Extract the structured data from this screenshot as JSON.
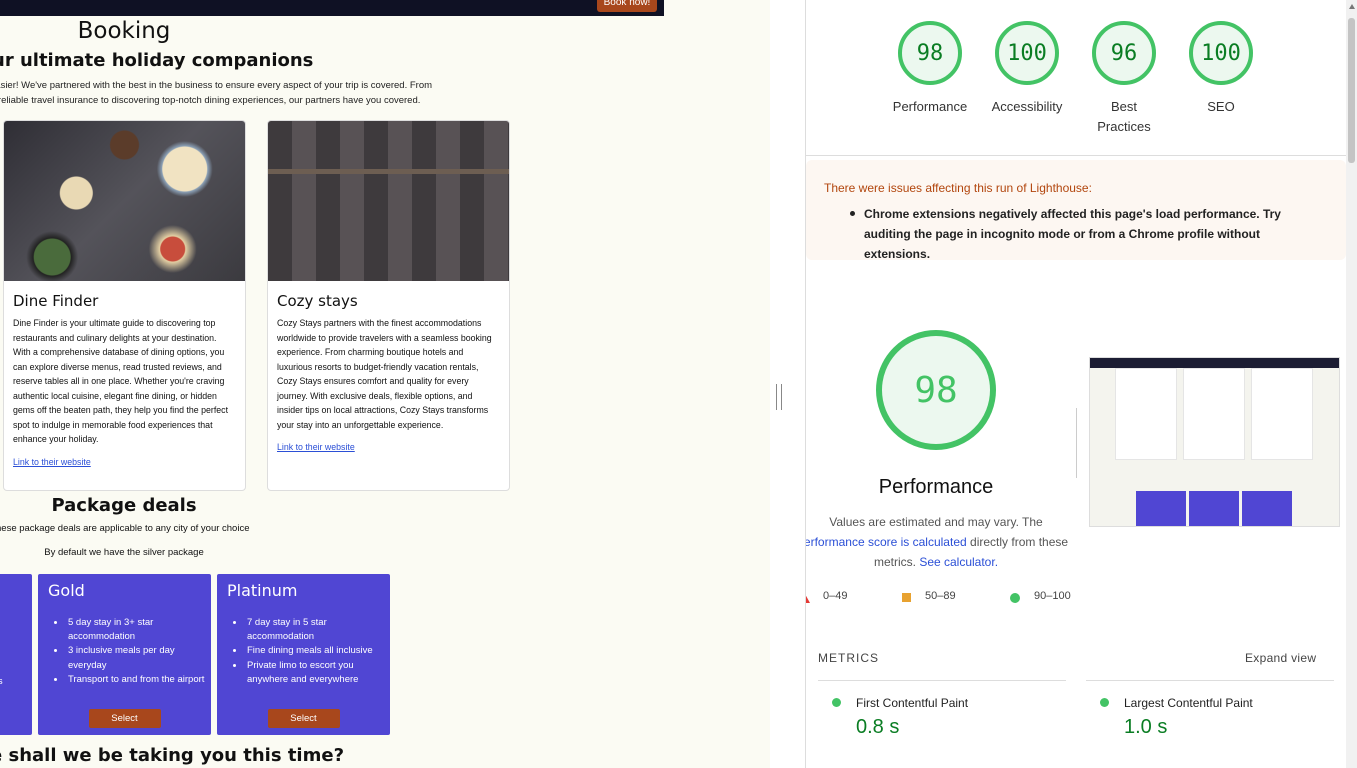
{
  "site": {
    "nav": {
      "book_now": "Book now!"
    },
    "booking_title": "Booking",
    "companions_title": "ur ultimate holiday companions",
    "intro_line1": "easier! We've partnered with the best in the business to ensure every aspect of your trip is covered. From",
    "intro_line2": "g reliable travel insurance to discovering top-notch dining experiences, our partners have you covered.",
    "cards": [
      {
        "title": "Dine Finder",
        "text": "Dine Finder is your ultimate guide to discovering top restaurants and culinary delights at your destination. With a comprehensive database of dining options, you can explore diverse menus, read trusted reviews, and reserve tables all in one place. Whether you're craving authentic local cuisine, elegant fine dining, or hidden gems off the beaten path, they help you find the perfect spot to indulge in memorable food experiences that enhance your holiday.",
        "link": "Link to their website"
      },
      {
        "title": "Cozy stays",
        "text": "Cozy Stays partners with the finest accommodations worldwide to provide travelers with a seamless booking experience. From charming boutique hotels and luxurious resorts to budget-friendly vacation rentals, Cozy Stays ensures comfort and quality for every journey. With exclusive deals, flexible options, and insider tips on local attractions, Cozy Stays transforms your stay into an unforgettable experience.",
        "link": "Link to their website"
      }
    ],
    "package_title": "Package deals",
    "package_sub1": "hese package deals are applicable to any city of your choice",
    "package_sub2": "By default we have the silver package",
    "silver_fragment": "ms",
    "packages": [
      {
        "name": "Gold",
        "items": [
          "5 day stay in 3+ star accommodation",
          "3 inclusive meals per day everyday",
          "Transport to and from the airport"
        ],
        "select": "Select"
      },
      {
        "name": "Platinum",
        "items": [
          "7 day stay in 5 star accommodation",
          "Fine dining meals all inclusive",
          "Private limo to escort you anywhere and everywhere"
        ],
        "select": "Select"
      }
    ],
    "where_title": "e shall we be taking you this time?"
  },
  "lighthouse": {
    "scores": [
      {
        "label": "Performance",
        "value": "98"
      },
      {
        "label": "Accessibility",
        "value": "100"
      },
      {
        "label": "Best Practices",
        "value": "96"
      },
      {
        "label": "SEO",
        "value": "100"
      }
    ],
    "warning_title": "There were issues affecting this run of Lighthouse:",
    "warning_item": "Chrome extensions negatively affected this page's load performance. Try auditing the page in incognito mode or from a Chrome profile without extensions.",
    "perf_score": "98",
    "perf_title": "Performance",
    "vary_text1": "Values are estimated and may vary. The",
    "vary_link1": "erformance score is calculated",
    "vary_text2": "directly from these",
    "vary_text3": "metrics.",
    "vary_link2": "See calculator.",
    "legend": [
      "0–49",
      "50–89",
      "90–100"
    ],
    "metrics_label": "METRICS",
    "expand_view": "Expand view",
    "metrics": [
      {
        "name": "First Contentful Paint",
        "value": "0.8 s"
      },
      {
        "name": "Largest Contentful Paint",
        "value": "1.0 s"
      }
    ],
    "colors": {
      "pass": "#43c365",
      "average": "#e8a230",
      "fail": "#e53935"
    }
  }
}
